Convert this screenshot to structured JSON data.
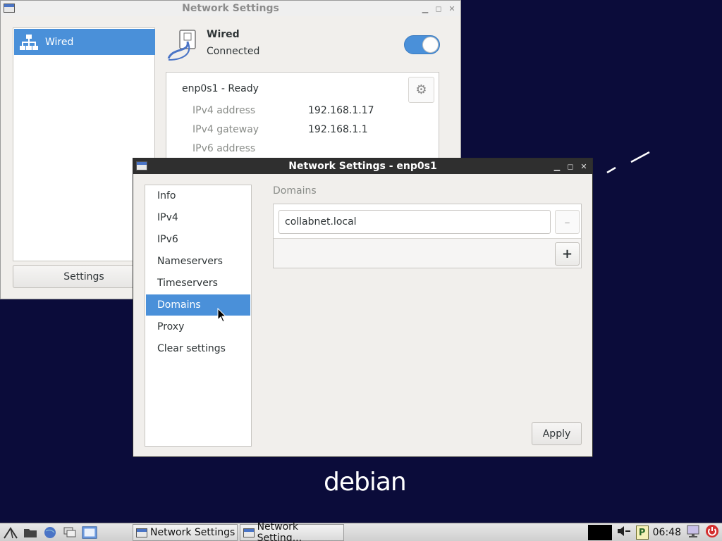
{
  "desktop": {
    "logo_text": "debian"
  },
  "main_window": {
    "title": "Network Settings",
    "sidebar": {
      "items": [
        {
          "label": "Wired",
          "icon": "wired-network-icon",
          "selected": true
        }
      ]
    },
    "settings_button": "Settings",
    "connection": {
      "name": "Wired",
      "status": "Connected",
      "enabled": true
    },
    "interface": {
      "title": "enp0s1 - Ready",
      "rows": [
        {
          "label": "IPv4 address",
          "value": "192.168.1.17"
        },
        {
          "label": "IPv4 gateway",
          "value": "192.168.1.1"
        },
        {
          "label": "IPv6 address",
          "value": ""
        }
      ]
    }
  },
  "dialog": {
    "title": "Network Settings - enp0s1",
    "pages": [
      "Info",
      "IPv4",
      "IPv6",
      "Nameservers",
      "Timeservers",
      "Domains",
      "Proxy",
      "Clear settings"
    ],
    "selected_page": "Domains",
    "section_heading": "Domains",
    "domains": [
      {
        "value": "collabnet.local"
      }
    ],
    "remove_label": "–",
    "add_label": "+",
    "apply_label": "Apply"
  },
  "taskbar": {
    "tasks": [
      {
        "label": "Network Settings"
      },
      {
        "label": "Network Setting..."
      }
    ],
    "clock": "06:48",
    "tray_p_label": "P"
  },
  "colors": {
    "selection": "#4a90d9",
    "desktop": "#0b0c3a",
    "dialog_titlebar": "#2f2f2f"
  }
}
